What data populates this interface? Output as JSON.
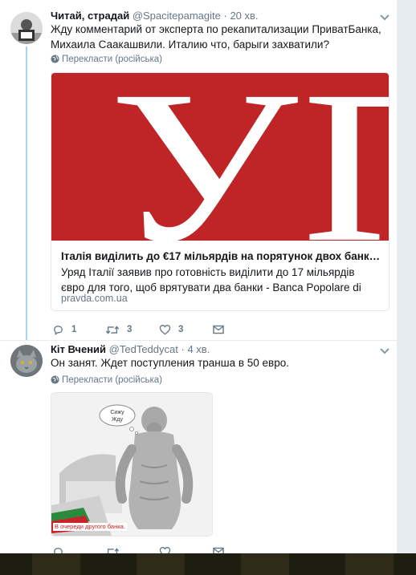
{
  "tweets": [
    {
      "name": "Читай, страдай",
      "handle": "@Spacitepamagite",
      "dot": "·",
      "time": "20 хв.",
      "text": "Жду комментарий от эксперта по рекапитализации ПриватБанка, Михаила Саакашвили. Италию что, барыги захватили?",
      "translate_label": "Перекласти (російська)",
      "card": {
        "logo_text": "УП",
        "title": "Італія виділить до €17 мільярдів на порятунок двох банків від ба...",
        "description": "Уряд Італії заявив про готовність виділити до 17 мільярдів євро для того, щоб врятувати два банки - Banca Popolare di Vicenza та V...",
        "domain": "pravda.com.ua"
      },
      "replies": "1",
      "retweets": "3",
      "likes": "3"
    },
    {
      "name": "Кіт Вчений",
      "handle": "@TedTeddycat",
      "dot": "·",
      "time": "4 хв.",
      "text": "Он занят. Ждет поступления транша в 50 евро.",
      "translate_label": "Перекласти (російська)",
      "media": {
        "bubble_text_1": "Сижу",
        "bubble_text_2": "Жду",
        "caption": "В очереди другого банка."
      },
      "replies": "",
      "retweets": "",
      "likes": ""
    }
  ],
  "colors": {
    "link_blue": "#1da1f2",
    "thread_line": "#a3d4f2",
    "muted": "#657786",
    "up_red": "#bf2426"
  },
  "icons": [
    "chevron-down-icon",
    "globe-icon",
    "reply-icon",
    "retweet-icon",
    "heart-icon",
    "envelope-icon"
  ]
}
